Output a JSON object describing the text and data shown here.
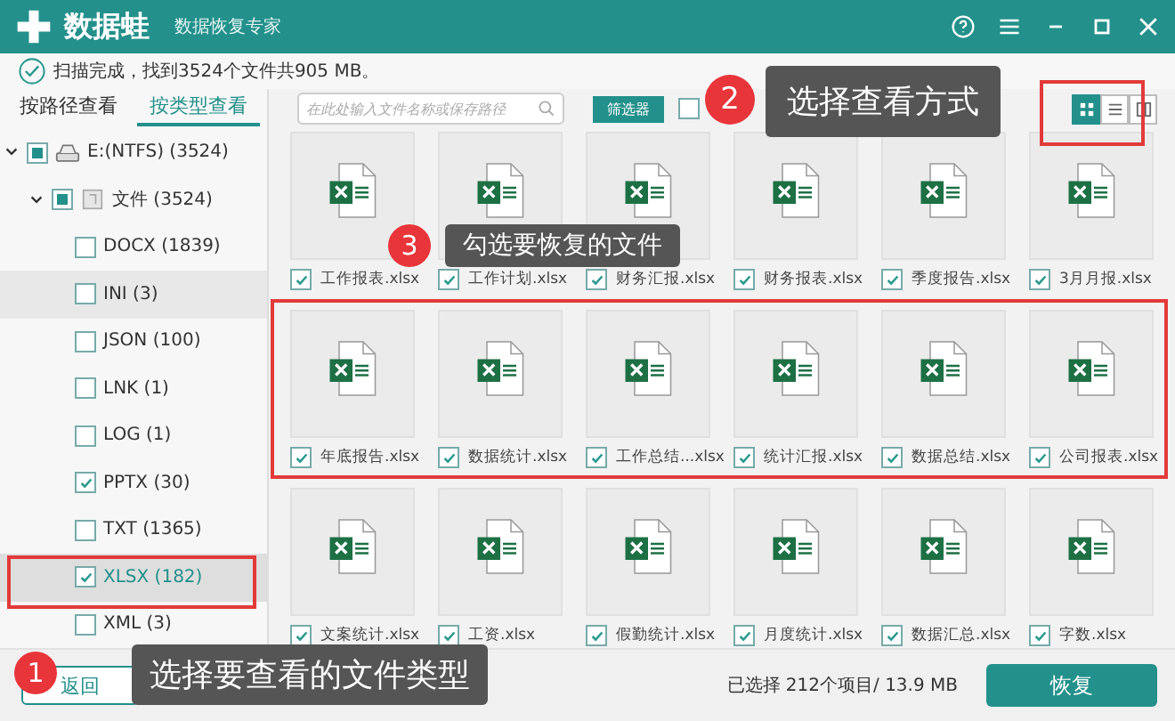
{
  "window": {
    "app_name": "数据蛙",
    "subtitle": "数据恢复专家"
  },
  "status": {
    "message": "扫描完成，找到3524个文件共905 MB。"
  },
  "tabs": [
    {
      "label": "按路径查看",
      "selected": false
    },
    {
      "label": "按类型查看",
      "selected": true
    }
  ],
  "tree": [
    {
      "label": "E:(NTFS) (3524)",
      "kind": "drive",
      "partial": true,
      "expanded": true,
      "children": [
        {
          "label": "文件 (3524)",
          "kind": "folder",
          "partial": true,
          "expanded": true,
          "children": [
            {
              "label": "DOCX (1839)",
              "checked": false,
              "selected": false,
              "hovered": false
            },
            {
              "label": "INI (3)",
              "checked": false,
              "selected": false,
              "hovered": true
            },
            {
              "label": "JSON (100)",
              "checked": false,
              "selected": false,
              "hovered": false
            },
            {
              "label": "LNK (1)",
              "checked": false,
              "selected": false,
              "hovered": false
            },
            {
              "label": "LOG (1)",
              "checked": false,
              "selected": false,
              "hovered": false
            },
            {
              "label": "PPTX (30)",
              "checked": true,
              "selected": false,
              "hovered": false
            },
            {
              "label": "TXT (1365)",
              "checked": false,
              "selected": false,
              "hovered": false
            },
            {
              "label": "XLSX (182)",
              "checked": true,
              "selected": true,
              "hovered": false
            },
            {
              "label": "XML (3)",
              "checked": false,
              "selected": false,
              "hovered": false
            }
          ]
        }
      ]
    }
  ],
  "toolbar": {
    "search": {
      "placeholder": "在此处输入文件名称或保存路径"
    },
    "filter_button": "筛选器",
    "filter_checkbox": {
      "checked": false
    },
    "view_modes": [
      {
        "kind": "grid",
        "selected": true
      },
      {
        "kind": "list",
        "selected": false
      },
      {
        "kind": "columns",
        "selected": false
      }
    ]
  },
  "files": [
    {
      "name": "工作报表.xlsx",
      "checked": true
    },
    {
      "name": "工作计划.xlsx",
      "checked": true
    },
    {
      "name": "财务汇报.xlsx",
      "checked": true
    },
    {
      "name": "财务报表.xlsx",
      "checked": true
    },
    {
      "name": "季度报告.xlsx",
      "checked": true
    },
    {
      "name": "3月月报.xlsx",
      "checked": true
    },
    {
      "name": "年底报告.xlsx",
      "checked": true
    },
    {
      "name": "数据统计.xlsx",
      "checked": true
    },
    {
      "name": "工作总结...xlsx",
      "checked": true
    },
    {
      "name": "统计汇报.xlsx",
      "checked": true
    },
    {
      "name": "数据总结.xlsx",
      "checked": true
    },
    {
      "name": "公司报表.xlsx",
      "checked": true
    },
    {
      "name": "文案统计.xlsx",
      "checked": true
    },
    {
      "name": "工资.xlsx",
      "checked": true
    },
    {
      "name": "假勤统计.xlsx",
      "checked": true
    },
    {
      "name": "月度统计.xlsx",
      "checked": true
    },
    {
      "name": "数据汇总.xlsx",
      "checked": true
    },
    {
      "name": "字数.xlsx",
      "checked": true
    }
  ],
  "footer": {
    "back_button": "返回",
    "summary": "已选择 212个项目/ 13.9 MB",
    "recover_button": "恢复"
  },
  "annotations": [
    {
      "number": "1",
      "text": "选择要查看的文件类型"
    },
    {
      "number": "2",
      "text": "选择查看方式"
    },
    {
      "number": "3",
      "text": "勾选要恢复的文件"
    }
  ]
}
